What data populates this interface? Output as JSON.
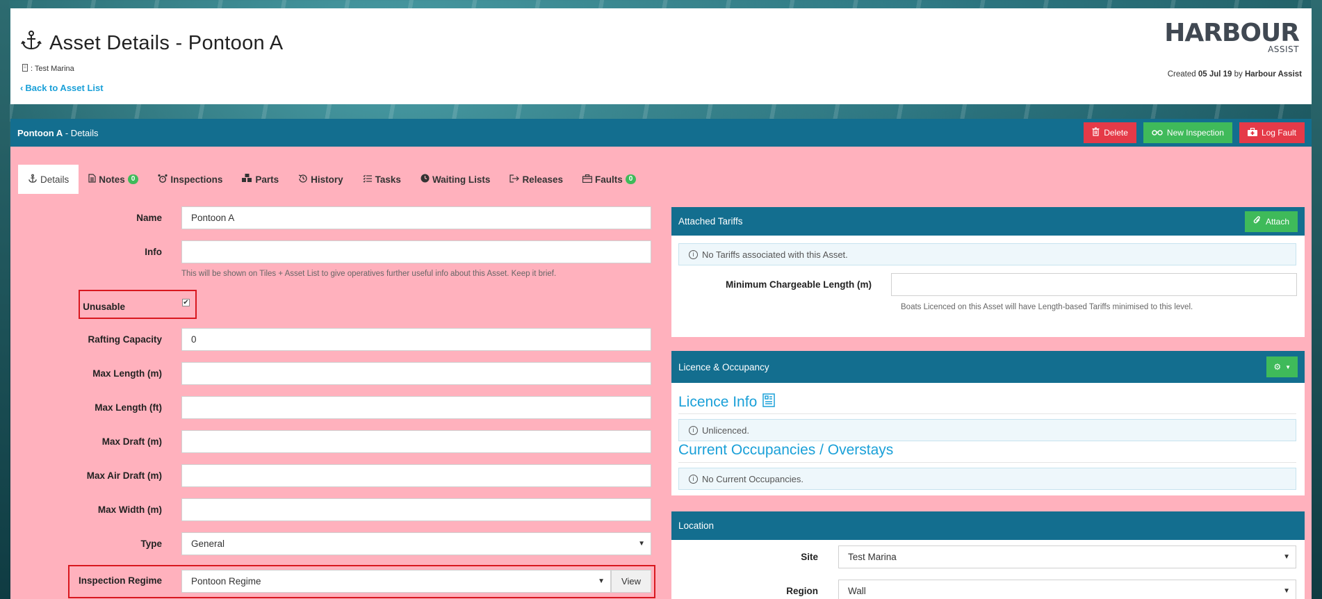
{
  "header": {
    "title": "Asset Details - Pontoon A",
    "marina": ": Test Marina",
    "back_link": "Back to Asset List",
    "brand_main": "HARBOUR",
    "brand_sub": "ASSIST",
    "created_prefix": "Created",
    "created_date": "05 Jul 19",
    "created_by_prefix": "by",
    "created_by": "Harbour Assist"
  },
  "panel": {
    "asset_name": "Pontoon A",
    "subtitle": "- Details",
    "actions": {
      "delete": "Delete",
      "new_inspection": "New Inspection",
      "log_fault": "Log Fault"
    }
  },
  "tabs": [
    {
      "label": "Details"
    },
    {
      "label": "Notes",
      "badge": "0"
    },
    {
      "label": "Inspections"
    },
    {
      "label": "Parts"
    },
    {
      "label": "History"
    },
    {
      "label": "Tasks"
    },
    {
      "label": "Waiting Lists"
    },
    {
      "label": "Releases"
    },
    {
      "label": "Faults",
      "badge": "0"
    }
  ],
  "form": {
    "name": {
      "label": "Name",
      "value": "Pontoon A"
    },
    "info": {
      "label": "Info",
      "value": "",
      "help": "This will be shown on Tiles + Asset List to give operatives further useful info about this Asset. Keep it brief."
    },
    "unusable": {
      "label": "Unusable",
      "checked": true
    },
    "rafting_capacity": {
      "label": "Rafting Capacity",
      "value": "0"
    },
    "max_length_m": {
      "label": "Max Length (m)",
      "value": ""
    },
    "max_length_ft": {
      "label": "Max Length (ft)",
      "value": ""
    },
    "max_draft_m": {
      "label": "Max Draft (m)",
      "value": ""
    },
    "max_air_draft_m": {
      "label": "Max Air Draft (m)",
      "value": ""
    },
    "max_width_m": {
      "label": "Max Width (m)",
      "value": ""
    },
    "type": {
      "label": "Type",
      "value": "General"
    },
    "inspection_regime": {
      "label": "Inspection Regime",
      "value": "Pontoon Regime",
      "view": "View"
    }
  },
  "tariffs": {
    "title": "Attached Tariffs",
    "attach": "Attach",
    "no_tariffs": "No Tariffs associated with this Asset.",
    "min_length_label": "Minimum Chargeable Length (m)",
    "min_length_value": "",
    "min_length_help": "Boats Licenced on this Asset will have Length-based Tariffs minimised to this level."
  },
  "licence": {
    "title": "Licence & Occupancy",
    "licence_info": "Licence Info",
    "unlicenced": "Unlicenced.",
    "occupancies_title": "Current Occupancies / Overstays",
    "no_occupancies": "No Current Occupancies."
  },
  "location": {
    "title": "Location",
    "site_label": "Site",
    "site_value": "Test Marina",
    "region_label": "Region",
    "region_value": "Wall"
  },
  "colors": {
    "panel_bg": "#ffb1bd",
    "header_blue": "#136e8f",
    "danger": "#e53a48",
    "success": "#3fba5a",
    "link": "#1aa0d8",
    "highlight": "#d8171f"
  }
}
